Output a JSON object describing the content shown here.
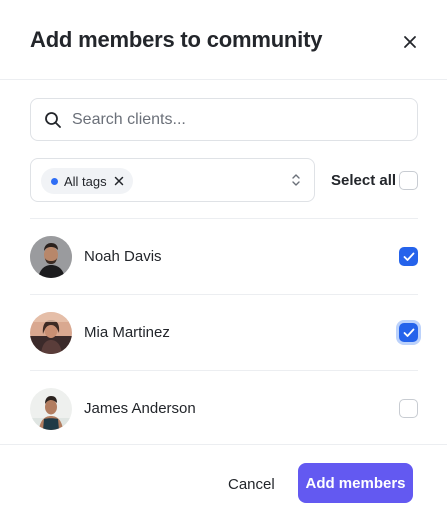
{
  "dialog": {
    "title": "Add members to community",
    "close_icon": "close-icon"
  },
  "search": {
    "placeholder": "Search clients...",
    "value": "",
    "icon": "search-icon"
  },
  "tag_filter": {
    "selected_tag": "All tags",
    "tag_dot_color": "#2f6ef5",
    "remove_icon": "close-icon",
    "toggle_icon": "chevron-up-down-icon"
  },
  "select_all": {
    "label": "Select all",
    "checked": false
  },
  "members": [
    {
      "name": "Noah Davis",
      "checked": true,
      "avatar_icon": "avatar"
    },
    {
      "name": "Mia Martinez",
      "checked": true,
      "avatar_icon": "avatar"
    },
    {
      "name": "James Anderson",
      "checked": false,
      "avatar_icon": "avatar"
    }
  ],
  "footer": {
    "cancel_label": "Cancel",
    "submit_label": "Add members"
  },
  "colors": {
    "accent": "#6359f1",
    "checkbox_checked": "#2563eb"
  }
}
